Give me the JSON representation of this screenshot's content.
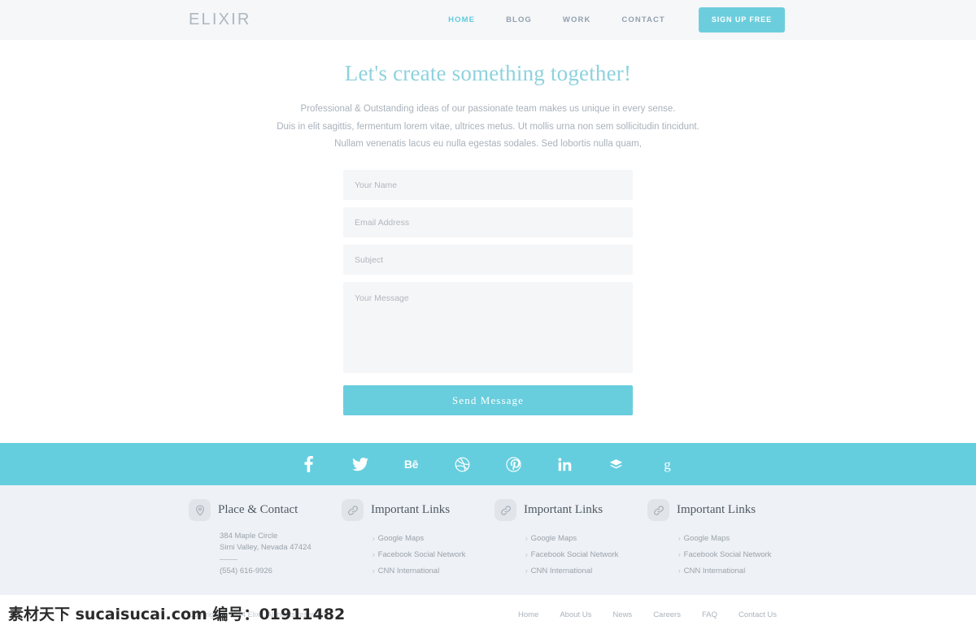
{
  "header": {
    "brand": "ELIXIR",
    "nav": [
      {
        "label": "HOME",
        "active": true
      },
      {
        "label": "BLOG",
        "active": false
      },
      {
        "label": "WORK",
        "active": false
      },
      {
        "label": "CONTACT",
        "active": false
      }
    ],
    "signup_label": "SIGN UP FREE",
    "accent_color": "#6ccedd",
    "background_color": "#f5f7f9"
  },
  "contact": {
    "title": "Let's create something together!",
    "intro_lines": [
      "Professional & Outstanding ideas  of our passionate team makes us unique in every sense.",
      "Duis in elit sagittis, fermentum lorem vitae, ultrices metus. Ut mollis urna non sem sollicitudin tincidunt.",
      "Nullam venenatis lacus eu nulla egestas sodales. Sed lobortis nulla quam,"
    ],
    "title_color": "#8ed2dd",
    "form": {
      "name_placeholder": "Your Name",
      "name_value": "",
      "email_placeholder": "Email Address",
      "email_value": "",
      "subject_placeholder": "Subject",
      "subject_value": "",
      "message_placeholder": "Your Message",
      "message_value": "",
      "submit_label": "Send Message",
      "submit_color": "#68cddd"
    }
  },
  "social_bar": {
    "background_color": "#65cede",
    "items": [
      {
        "icon": "facebook-icon",
        "name": "Facebook"
      },
      {
        "icon": "twitter-icon",
        "name": "Twitter"
      },
      {
        "icon": "behance-icon",
        "name": "Behance"
      },
      {
        "icon": "dribbble-icon",
        "name": "Dribbble"
      },
      {
        "icon": "pinterest-icon",
        "name": "Pinterest"
      },
      {
        "icon": "linkedin-icon",
        "name": "LinkedIn"
      },
      {
        "icon": "foursquare-icon",
        "name": "Foursquare"
      },
      {
        "icon": "google-plus-icon",
        "name": "Google"
      }
    ]
  },
  "footer": {
    "background_color": "#eef1f5",
    "columns": [
      {
        "icon": "map-pin-icon",
        "title": "Place & Contact",
        "type": "address",
        "address_line1": "384 Maple Circle",
        "address_line2": "Simi Valley, Nevada 47424",
        "phone": "(554) 616-9926"
      },
      {
        "icon": "link-icon",
        "title": "Important Links",
        "type": "links",
        "links": [
          "Google Maps",
          "Facebook Social Network",
          "CNN International"
        ]
      },
      {
        "icon": "link-icon",
        "title": "Important Links",
        "type": "links",
        "links": [
          "Google Maps",
          "Facebook Social Network",
          "CNN International"
        ]
      },
      {
        "icon": "link-icon",
        "title": "Important Links",
        "type": "links",
        "links": [
          "Google Maps",
          "Facebook Social Network",
          "CNN International"
        ]
      }
    ]
  },
  "bottom_bar": {
    "copyright": "Copyright © 2014 Elixir. All rights reserved.",
    "links": [
      "Home",
      "About Us",
      "News",
      "Careers",
      "FAQ",
      "Contact Us"
    ]
  },
  "watermark": {
    "text": "素材天下 sucaisucai.com 编号：01911482"
  }
}
